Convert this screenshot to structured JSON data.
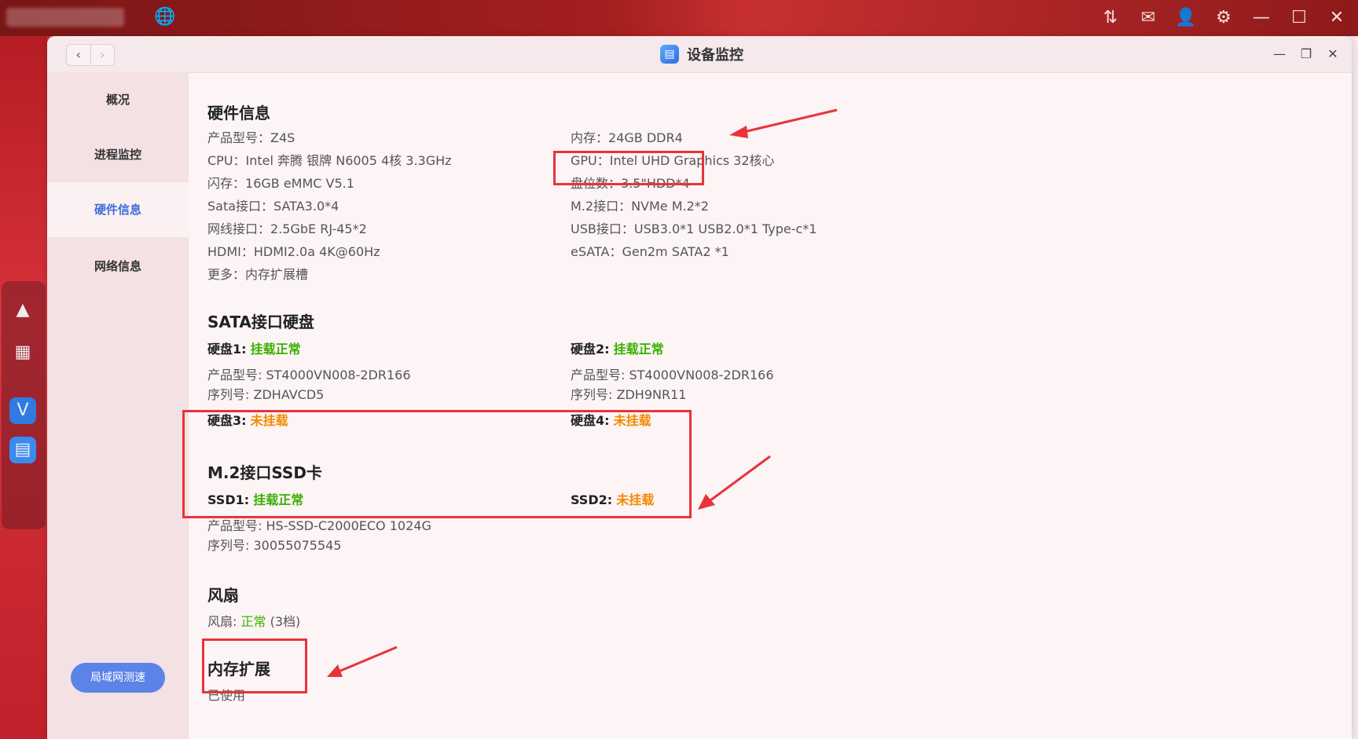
{
  "window": {
    "title": "设备监控"
  },
  "sidebar": {
    "items": [
      {
        "label": "概况"
      },
      {
        "label": "进程监控"
      },
      {
        "label": "硬件信息"
      },
      {
        "label": "网络信息"
      }
    ],
    "speed_button": "局域网测速"
  },
  "hardware": {
    "title": "硬件信息",
    "left": [
      {
        "label": "产品型号：",
        "value": "Z4S"
      },
      {
        "label": "CPU：",
        "value": "Intel 奔腾 银牌 N6005 4核 3.3GHz"
      },
      {
        "label": "闪存：",
        "value": "16GB eMMC V5.1"
      },
      {
        "label": "Sata接口：",
        "value": "SATA3.0*4"
      },
      {
        "label": "网线接口：",
        "value": "2.5GbE RJ-45*2"
      },
      {
        "label": "HDMI：",
        "value": "HDMI2.0a 4K@60Hz"
      },
      {
        "label": "更多：",
        "value": "内存扩展槽"
      }
    ],
    "right": [
      {
        "label": "内存：",
        "value": "24GB DDR4"
      },
      {
        "label": "GPU：",
        "value": "Intel UHD Graphics 32核心"
      },
      {
        "label": "盘位数：",
        "value": "3.5\"HDD*4"
      },
      {
        "label": "M.2接口：",
        "value": "NVMe M.2*2"
      },
      {
        "label": "USB接口：",
        "value": "USB3.0*1 USB2.0*1 Type-c*1"
      },
      {
        "label": "eSATA：",
        "value": "Gen2m SATA2 *1"
      }
    ]
  },
  "sata": {
    "title": "SATA接口硬盘",
    "disks": [
      {
        "name": "硬盘1:",
        "status": "挂载正常",
        "model_label": "产品型号:",
        "model": "ST4000VN008-2DR166",
        "serial_label": "序列号:",
        "serial": "ZDHAVCD5"
      },
      {
        "name": "硬盘2:",
        "status": "挂载正常",
        "model_label": "产品型号:",
        "model": "ST4000VN008-2DR166",
        "serial_label": "序列号:",
        "serial": "ZDH9NR11"
      },
      {
        "name": "硬盘3:",
        "status": "未挂载"
      },
      {
        "name": "硬盘4:",
        "status": "未挂载"
      }
    ]
  },
  "m2": {
    "title": "M.2接口SSD卡",
    "ssds": [
      {
        "name": "SSD1:",
        "status": "挂载正常",
        "model_label": "产品型号:",
        "model": "HS-SSD-C2000ECO 1024G",
        "serial_label": "序列号:",
        "serial": "30055075545"
      },
      {
        "name": "SSD2:",
        "status": "未挂载"
      }
    ]
  },
  "fan": {
    "title": "风扇",
    "label": "风扇:",
    "status": "正常",
    "level": "(3档)"
  },
  "memory_ext": {
    "title": "内存扩展",
    "status": "已使用"
  },
  "colors": {
    "accent": "#3d6fd8",
    "ok": "#3bb000",
    "warn": "#f28a00",
    "annotation": "#e8333b"
  }
}
